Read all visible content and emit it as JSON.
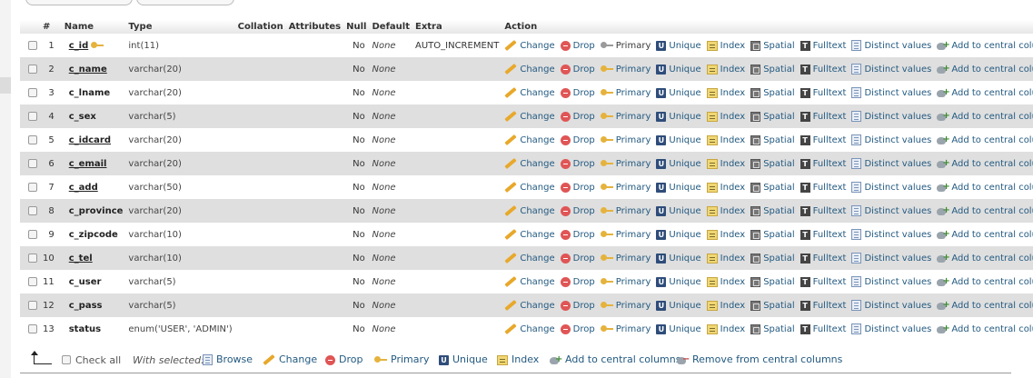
{
  "top_controls": {
    "search_stub_text": "",
    "second_stub_text": ""
  },
  "headers": {
    "num": "#",
    "name": "Name",
    "type": "Type",
    "collation": "Collation",
    "attributes": "Attributes",
    "null": "Null",
    "default": "Default",
    "extra": "Extra",
    "action": "Action"
  },
  "action_labels": {
    "change": "Change",
    "drop": "Drop",
    "primary": "Primary",
    "unique": "Unique",
    "index": "Index",
    "spatial": "Spatial",
    "fulltext": "Fulltext",
    "distinct": "Distinct values",
    "central": "Add to central columns"
  },
  "rows": [
    {
      "num": "1",
      "name": "c_id",
      "type": "int(11)",
      "collation": "",
      "attributes": "",
      "null": "No",
      "default": "None",
      "extra": "AUTO_INCREMENT",
      "primary_key": true
    },
    {
      "num": "2",
      "name": "c_name",
      "type": "varchar(20)",
      "collation": "",
      "attributes": "",
      "null": "No",
      "default": "None",
      "extra": "",
      "primary_key": false
    },
    {
      "num": "3",
      "name": "c_lname",
      "type": "varchar(20)",
      "collation": "",
      "attributes": "",
      "null": "No",
      "default": "None",
      "extra": "",
      "primary_key": false
    },
    {
      "num": "4",
      "name": "c_sex",
      "type": "varchar(5)",
      "collation": "",
      "attributes": "",
      "null": "No",
      "default": "None",
      "extra": "",
      "primary_key": false
    },
    {
      "num": "5",
      "name": "c_idcard",
      "type": "varchar(20)",
      "collation": "",
      "attributes": "",
      "null": "No",
      "default": "None",
      "extra": "",
      "primary_key": false
    },
    {
      "num": "6",
      "name": "c_email",
      "type": "varchar(20)",
      "collation": "",
      "attributes": "",
      "null": "No",
      "default": "None",
      "extra": "",
      "primary_key": false
    },
    {
      "num": "7",
      "name": "c_add",
      "type": "varchar(50)",
      "collation": "",
      "attributes": "",
      "null": "No",
      "default": "None",
      "extra": "",
      "primary_key": false
    },
    {
      "num": "8",
      "name": "c_province",
      "type": "varchar(20)",
      "collation": "",
      "attributes": "",
      "null": "No",
      "default": "None",
      "extra": "",
      "primary_key": false
    },
    {
      "num": "9",
      "name": "c_zipcode",
      "type": "varchar(10)",
      "collation": "",
      "attributes": "",
      "null": "No",
      "default": "None",
      "extra": "",
      "primary_key": false
    },
    {
      "num": "10",
      "name": "c_tel",
      "type": "varchar(10)",
      "collation": "",
      "attributes": "",
      "null": "No",
      "default": "None",
      "extra": "",
      "primary_key": false
    },
    {
      "num": "11",
      "name": "c_user",
      "type": "varchar(5)",
      "collation": "",
      "attributes": "",
      "null": "No",
      "default": "None",
      "extra": "",
      "primary_key": false
    },
    {
      "num": "12",
      "name": "c_pass",
      "type": "varchar(5)",
      "collation": "",
      "attributes": "",
      "null": "No",
      "default": "None",
      "extra": "",
      "primary_key": false
    },
    {
      "num": "13",
      "name": "status",
      "type": "enum('USER', 'ADMIN')",
      "collation": "",
      "attributes": "",
      "null": "No",
      "default": "None",
      "extra": "",
      "primary_key": false
    }
  ],
  "footer": {
    "check_all": "Check all",
    "with_selected": "With selected:",
    "browse": "Browse",
    "change": "Change",
    "drop": "Drop",
    "primary": "Primary",
    "unique": "Unique",
    "index": "Index",
    "add_central": "Add to central columns",
    "remove_central": "Remove from central columns"
  },
  "colors": {
    "link": "#235a81",
    "row_even": "#dfdfdf",
    "row_odd": "#ffffff",
    "drop_red": "#e05555",
    "key_gold": "#e5b33d"
  }
}
